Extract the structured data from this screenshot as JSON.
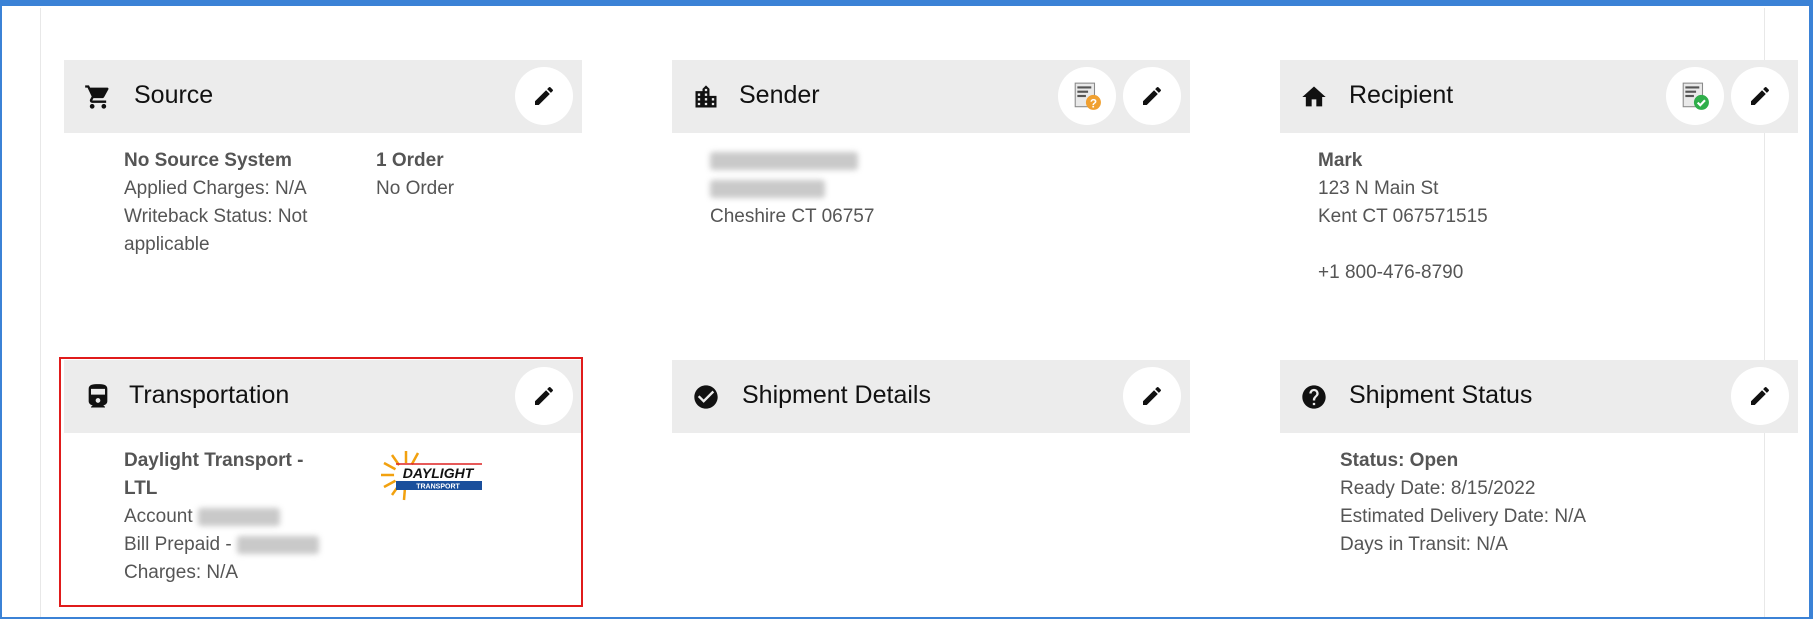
{
  "source": {
    "title": "Source",
    "icon": "cart-icon",
    "system": "No Source System",
    "applied_charges": "Applied Charges: N/A",
    "writeback_line1": "Writeback Status: Not",
    "writeback_line2": "applicable",
    "orders_count": "1 Order",
    "order_value": "No Order"
  },
  "sender": {
    "title": "Sender",
    "icon": "building-icon",
    "city_line": "Cheshire CT 06757"
  },
  "recipient": {
    "title": "Recipient",
    "icon": "home-icon",
    "name": "Mark",
    "street": "123 N Main St",
    "city_line": "Kent CT 067571515",
    "phone": "+1 800-476-8790"
  },
  "transportation": {
    "title": "Transportation",
    "icon": "train-icon",
    "carrier_line1": "Daylight Transport -",
    "carrier_line2": "LTL",
    "account_label": "Account",
    "bill_label": "Bill Prepaid -",
    "charges": "Charges: N/A",
    "logo_text": "DAYLIGHT",
    "logo_subtext": "TRANSPORT"
  },
  "shipment_details": {
    "title": "Shipment Details",
    "icon": "check-circle-icon"
  },
  "shipment_status": {
    "title": "Shipment Status",
    "icon": "help-circle-icon",
    "status": "Status: Open",
    "ready_date": "Ready Date: 8/15/2022",
    "estimated_delivery": "Estimated Delivery Date: N/A",
    "days_in_transit": "Days in Transit: N/A"
  },
  "colors": {
    "frame": "#3b82d6",
    "header_bg": "#ececec",
    "highlight": "#e01b1b",
    "text": "#555555"
  }
}
